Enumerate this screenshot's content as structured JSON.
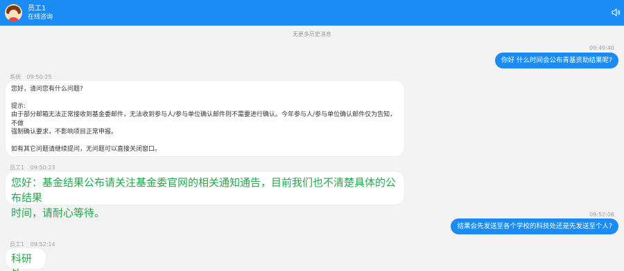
{
  "header": {
    "name": "员工1",
    "status": "在线咨询",
    "speaker_icon": "speaker-icon"
  },
  "history_notice": "无更多历史消息",
  "messages": [
    {
      "side": "out",
      "time": "09:49:40",
      "text": "你好 什么时间会公布青基资助结果呢?"
    },
    {
      "side": "in",
      "sender": "系统",
      "time": "09:50:25",
      "lines": [
        "您好，请问您有什么问题?",
        "",
        "提示:",
        "由于部分邮箱无法正常接收到基金委邮件，无法收到参与人/参与单位确认邮件则不需要进行确认。今年参与人/参与单位确认邮件仅为告知，不做",
        "强制确认要求，不影响项目正常申报。",
        "",
        "如有其它问题请继续提问，无问题可以直接关闭窗口。"
      ]
    },
    {
      "side": "in",
      "sender": "员工1",
      "time": "09:50:23",
      "lines": [
        "您好：基金结果公布请关注基金委官网的相关通知通告，目前我们也不清楚具体的公布结果",
        "时间，请耐心等待。"
      ]
    },
    {
      "side": "out",
      "time": "09:52:06",
      "text": "结果会先发送至各个学校的科技处还是先发送至个人?"
    },
    {
      "side": "in",
      "sender": "员工1",
      "time": "09:52:14",
      "lines": [
        "科研处"
      ]
    }
  ],
  "colors": {
    "accent": "#1a8cf3",
    "staff_text": "#23a84a",
    "background": "#f3f3f3"
  }
}
